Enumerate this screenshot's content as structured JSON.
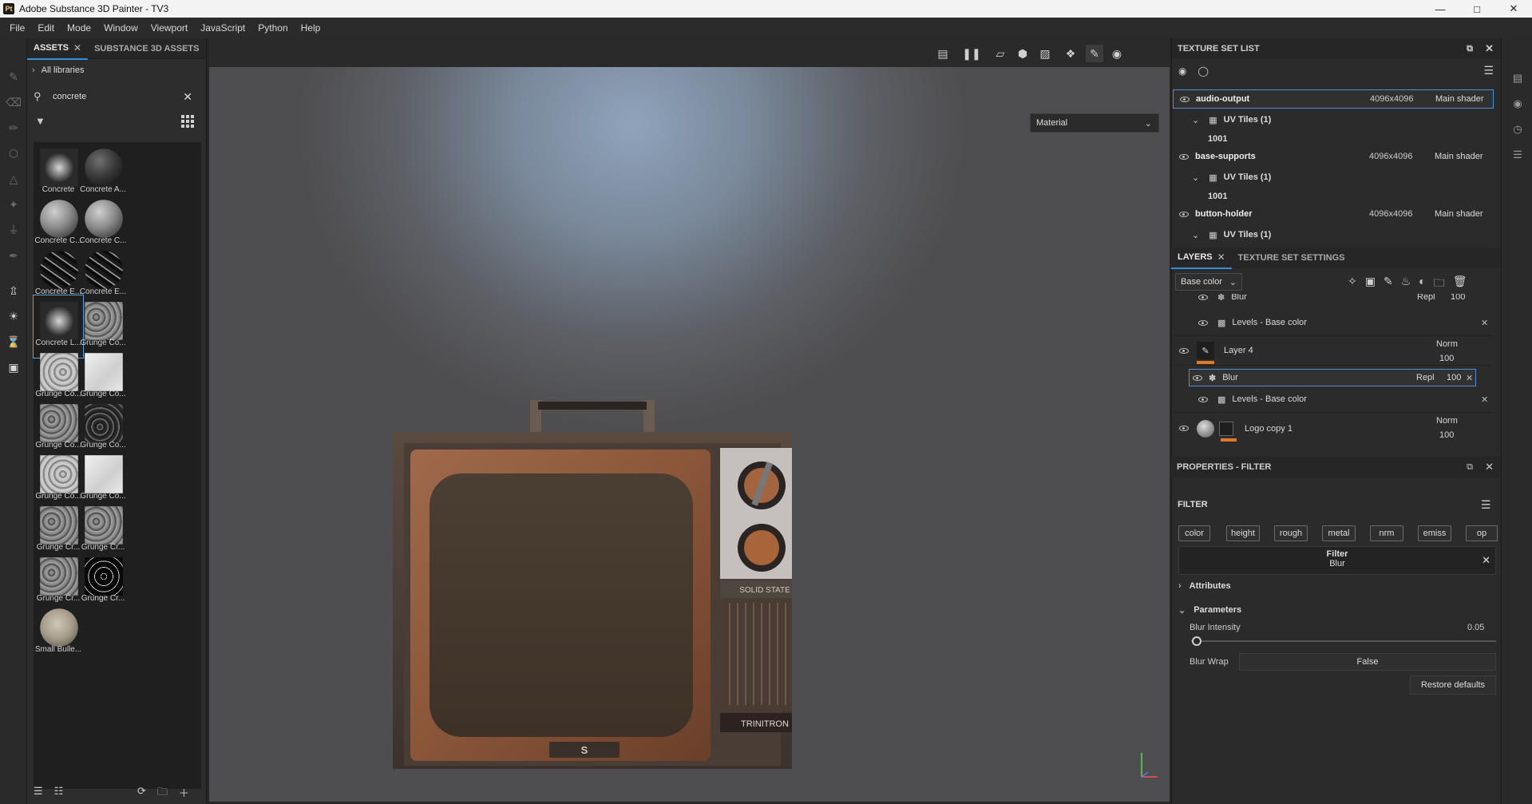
{
  "window": {
    "app_icon": "Pt",
    "title": "Adobe Substance 3D Painter - TV3",
    "controls": [
      "minimize-icon",
      "maximize-icon",
      "close-icon"
    ]
  },
  "menu": [
    "File",
    "Edit",
    "Mode",
    "Window",
    "Viewport",
    "JavaScript",
    "Python",
    "Help"
  ],
  "assets": {
    "tabs": [
      {
        "label": "ASSETS",
        "active": true
      },
      {
        "label": "SUBSTANCE 3D ASSETS",
        "active": false
      }
    ],
    "library": "All libraries",
    "search_value": "concrete",
    "items": [
      {
        "label": "Concrete",
        "kind": "stroke-light"
      },
      {
        "label": "Concrete A...",
        "kind": "sphere-dark"
      },
      {
        "label": "Concrete C...",
        "kind": "sphere-grey"
      },
      {
        "label": "Concrete C...",
        "kind": "sphere-grey"
      },
      {
        "label": "Concrete E...",
        "kind": "sphere-stripe"
      },
      {
        "label": "Concrete E...",
        "kind": "sphere-stripe"
      },
      {
        "label": "Concrete L...",
        "kind": "stroke-light",
        "selected": true
      },
      {
        "label": "Grunge Co...",
        "kind": "noise-mid"
      },
      {
        "label": "Grunge Co...",
        "kind": "noise-light"
      },
      {
        "label": "Grunge Co...",
        "kind": "noise-white"
      },
      {
        "label": "Grunge Co...",
        "kind": "noise-mid"
      },
      {
        "label": "Grunge Co...",
        "kind": "noise-dark"
      },
      {
        "label": "Grunge Co...",
        "kind": "noise-light"
      },
      {
        "label": "Grunge Co...",
        "kind": "noise-white"
      },
      {
        "label": "Grunge Cr...",
        "kind": "noise-mid"
      },
      {
        "label": "Grunge Cr...",
        "kind": "noise-mid"
      },
      {
        "label": "Grunge Cr...",
        "kind": "noise-mid"
      },
      {
        "label": "Grunge Cr...",
        "kind": "noise-black"
      },
      {
        "label": "Small Bulle...",
        "kind": "sphere-cream"
      }
    ]
  },
  "viewport": {
    "material_mode": "Material"
  },
  "tv": {
    "brand_top": "SOLID STATE",
    "brand_bottom": "TRINITRON",
    "logo_letter": "S"
  },
  "texture_set_list": {
    "title": "TEXTURE SET LIST",
    "sets": [
      {
        "name": "audio-output",
        "res": "4096x4096",
        "shader": "Main shader",
        "uv": "UV Tiles (1)",
        "tile": "1001",
        "selected": true
      },
      {
        "name": "base-supports",
        "res": "4096x4096",
        "shader": "Main shader",
        "uv": "UV Tiles (1)",
        "tile": "1001"
      },
      {
        "name": "button-holder",
        "res": "4096x4096",
        "shader": "Main shader",
        "uv": "UV Tiles (1)"
      }
    ]
  },
  "layers": {
    "tabs": [
      {
        "label": "LAYERS",
        "active": true
      },
      {
        "label": "TEXTURE SET SETTINGS",
        "active": false
      }
    ],
    "channel": "Base color",
    "rows": {
      "blur_top": {
        "name": "Blur",
        "blend": "Repl",
        "opacity": "100"
      },
      "levels_1": {
        "name": "Levels - Base color"
      },
      "layer4": {
        "name": "Layer 4",
        "blend": "Norm",
        "opacity": "100"
      },
      "blur_sel": {
        "name": "Blur",
        "blend": "Repl",
        "opacity": "100"
      },
      "levels_2": {
        "name": "Levels - Base color"
      },
      "logo": {
        "name": "Logo copy 1",
        "blend": "Norm",
        "opacity": "100"
      }
    }
  },
  "properties": {
    "title": "PROPERTIES - FILTER",
    "section": "FILTER",
    "channels": [
      "color",
      "height",
      "rough",
      "metal",
      "nrm",
      "emiss",
      "op"
    ],
    "filter_label": "Filter",
    "filter_name": "Blur",
    "attributes": "Attributes",
    "parameters": "Parameters",
    "blur_intensity_label": "Blur Intensity",
    "blur_intensity_value": "0.05",
    "blur_wrap_label": "Blur Wrap",
    "blur_wrap_value": "False",
    "restore": "Restore defaults"
  },
  "colors": {
    "accent": "#2f8fdc",
    "panel": "#2b2b2b",
    "orange": "#e07a2a"
  }
}
